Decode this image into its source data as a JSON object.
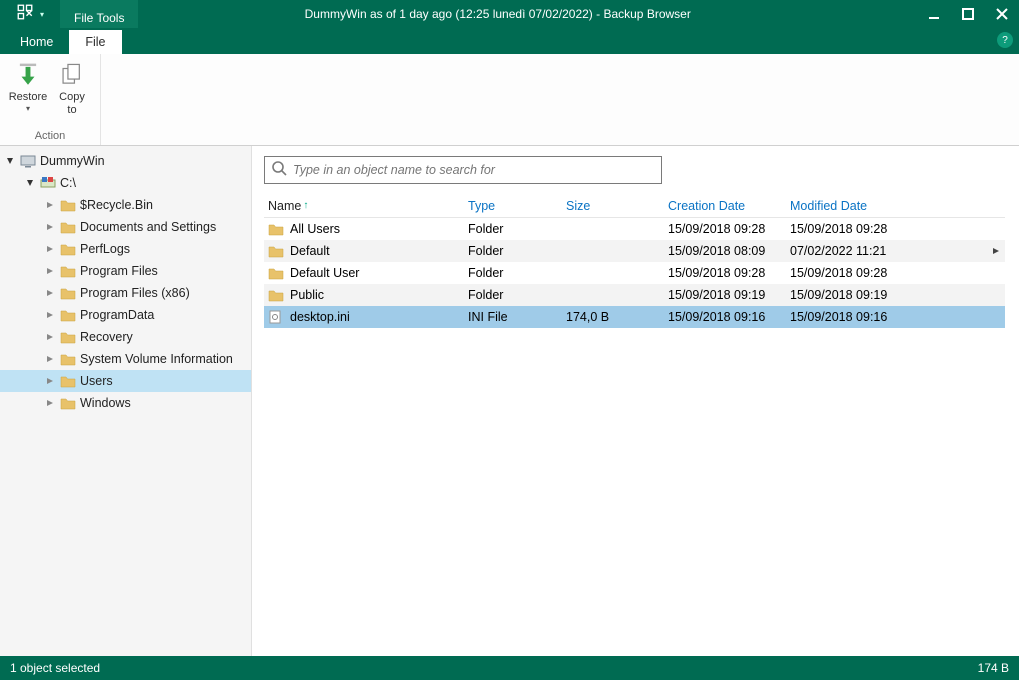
{
  "window": {
    "title": "DummyWin as of 1 day ago (12:25 lunedì 07/02/2022) - Backup Browser",
    "context_tab": "File Tools"
  },
  "ribbon": {
    "tabs": {
      "home": "Home",
      "file": "File"
    },
    "active_tab": "file",
    "group_label": "Action",
    "restore_label": "Restore",
    "copyto_label": "Copy\nto"
  },
  "tree": {
    "root": "DummyWin",
    "drive": "C:\\",
    "items": [
      "$Recycle.Bin",
      "Documents and Settings",
      "PerfLogs",
      "Program Files",
      "Program Files (x86)",
      "ProgramData",
      "Recovery",
      "System Volume Information",
      "Users",
      "Windows"
    ],
    "selected_index": 8
  },
  "search": {
    "placeholder": "Type in an object name to search for"
  },
  "columns": {
    "name": "Name",
    "type": "Type",
    "size": "Size",
    "creation": "Creation Date",
    "modified": "Modified Date"
  },
  "rows": [
    {
      "name": "All Users",
      "type": "Folder",
      "size": "",
      "cd": "15/09/2018 09:28",
      "md": "15/09/2018 09:28",
      "icon": "folder",
      "has_arrow": false
    },
    {
      "name": "Default",
      "type": "Folder",
      "size": "",
      "cd": "15/09/2018 08:09",
      "md": "07/02/2022 11:21",
      "icon": "folder",
      "has_arrow": true
    },
    {
      "name": "Default User",
      "type": "Folder",
      "size": "",
      "cd": "15/09/2018 09:28",
      "md": "15/09/2018 09:28",
      "icon": "folder",
      "has_arrow": false
    },
    {
      "name": "Public",
      "type": "Folder",
      "size": "",
      "cd": "15/09/2018 09:19",
      "md": "15/09/2018 09:19",
      "icon": "folder",
      "has_arrow": false
    },
    {
      "name": "desktop.ini",
      "type": "INI File",
      "size": "174,0 B",
      "cd": "15/09/2018 09:16",
      "md": "15/09/2018 09:16",
      "icon": "ini",
      "has_arrow": false
    }
  ],
  "selected_row": 4,
  "status": {
    "left": "1 object selected",
    "right": "174 B"
  }
}
